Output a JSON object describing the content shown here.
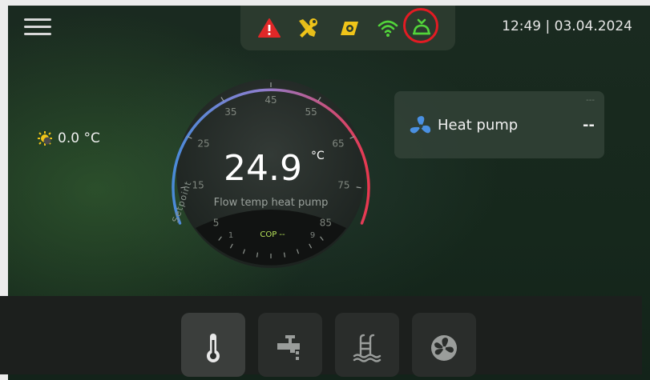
{
  "header": {
    "datetime": "12:49 | 03.04.2024",
    "status_icons": [
      "warning-icon",
      "tools-icon",
      "compressor-icon",
      "wifi-icon",
      "cloud-connection-icon"
    ]
  },
  "outdoor": {
    "temperature": "0.0 °C",
    "icon": "sun-icon"
  },
  "gauge": {
    "value": "24.9",
    "unit": "°C",
    "label": "Flow temp heat pump",
    "setpoint_label": "Setpoint",
    "scale_ticks": [
      "5",
      "15",
      "25",
      "35",
      "45",
      "55",
      "65",
      "75",
      "85"
    ],
    "cop_label": "COP --",
    "cop_min": "1",
    "cop_max": "9"
  },
  "heat_pump_card": {
    "name": "Heat pump",
    "value": "--",
    "small_value": "---"
  },
  "tabs": [
    {
      "name": "temperature-tab",
      "icon": "thermometer-icon",
      "active": true
    },
    {
      "name": "hot-water-tab",
      "icon": "tap-icon",
      "active": false
    },
    {
      "name": "pool-tab",
      "icon": "pool-icon",
      "active": false
    },
    {
      "name": "fan-tab",
      "icon": "fan-icon",
      "active": false
    }
  ],
  "colors": {
    "warning": "#e02828",
    "tools": "#f0c419",
    "compressor": "#f0c419",
    "wifi": "#52d43a",
    "cloud": "#52d43a",
    "highlight_ring": "#e31b23",
    "gauge_cold": "#4a8ad8",
    "gauge_hot": "#e8384f",
    "cop": "#b7e35a",
    "fan": "#4a90e2"
  }
}
